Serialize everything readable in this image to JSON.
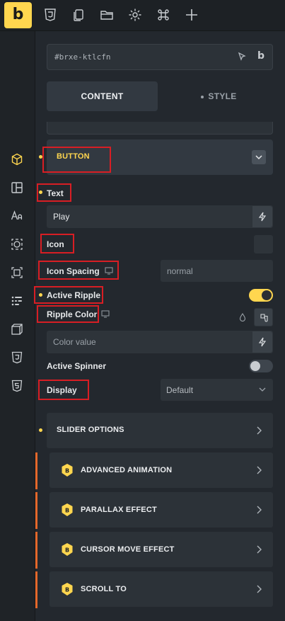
{
  "toolbar": {
    "logo": "b",
    "icons": [
      "css3-icon",
      "copy-pages-icon",
      "folder-icon",
      "gear-icon",
      "command-icon",
      "plus-icon"
    ]
  },
  "rail": {
    "icons": [
      "cube-icon",
      "layout-icon",
      "typography-icon",
      "frame-icon",
      "selection-icon",
      "grid-dots-icon",
      "3d-box-icon",
      "css3-icon",
      "html5-icon"
    ]
  },
  "element_id": "#brxe-ktlcfn",
  "tabs": {
    "content": "CONTENT",
    "style": "STYLE"
  },
  "section": {
    "title": "BUTTON"
  },
  "fields": {
    "text_label": "Text",
    "text_value": "Play",
    "icon_label": "Icon",
    "icon_spacing_label": "Icon Spacing",
    "icon_spacing_placeholder": "normal",
    "active_ripple_label": "Active Ripple",
    "ripple_color_label": "Ripple Color",
    "color_placeholder": "Color value",
    "active_spinner_label": "Active Spinner",
    "display_label": "Display",
    "display_value": "Default"
  },
  "toggles": {
    "active_ripple": true,
    "active_spinner": false
  },
  "accordions": {
    "slider_options": "SLIDER OPTIONS",
    "items": [
      "ADVANCED ANIMATION",
      "PARALLAX EFFECT",
      "CURSOR MOVE EFFECT",
      "SCROLL TO"
    ]
  },
  "colors": {
    "accent": "#ffd64f",
    "annotation": "#d81e24",
    "plugin_bar": "#e5682b"
  }
}
